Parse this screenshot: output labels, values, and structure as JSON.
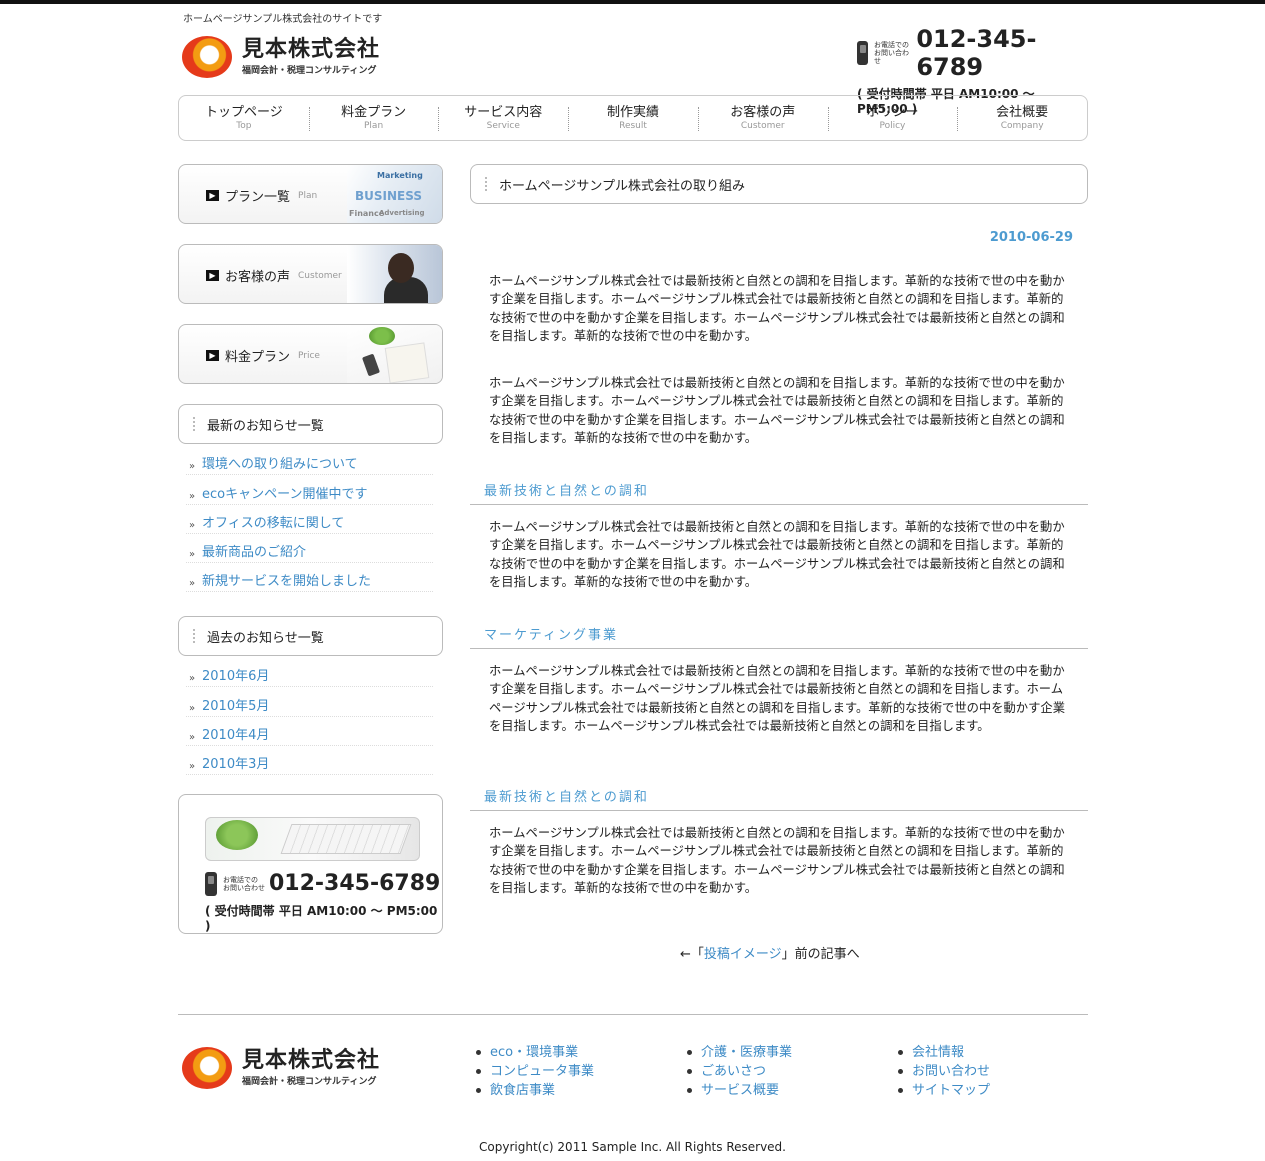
{
  "header": {
    "tagline": "ホームページサンプル株式会社のサイトです",
    "company_name": "見本株式会社",
    "company_sub": "福岡会計・税理コンサルティング",
    "tel_label_line1": "お電話での",
    "tel_label_line2": "お問い合わせ",
    "tel_number": "012-345-6789",
    "tel_hours": "( 受付時間帯 平日 AM10:00 〜 PM5:00 )"
  },
  "nav": [
    {
      "jp": "トップページ",
      "en": "Top"
    },
    {
      "jp": "料金プラン",
      "en": "Plan"
    },
    {
      "jp": "サービス内容",
      "en": "Service"
    },
    {
      "jp": "制作実績",
      "en": "Result"
    },
    {
      "jp": "お客様の声",
      "en": "Customer"
    },
    {
      "jp": "ポリシー",
      "en": "Policy"
    },
    {
      "jp": "会社概要",
      "en": "Company"
    }
  ],
  "sidebar": {
    "banners": [
      {
        "label": "プラン一覧",
        "en": "Plan"
      },
      {
        "label": "お客様の声",
        "en": "Customer"
      },
      {
        "label": "料金プラン",
        "en": "Price"
      }
    ],
    "banner_pic_words": [
      "Marketing",
      "BUSINESS",
      "Finance",
      "Advertising"
    ],
    "news_title": "最新のお知らせ一覧",
    "news": [
      "環境への取り組みについて",
      "ecoキャンペーン開催中です",
      "オフィスの移転に関して",
      "最新商品のご紹介",
      "新規サービスを開始しました"
    ],
    "archive_title": "過去のお知らせ一覧",
    "archives": [
      "2010年6月",
      "2010年5月",
      "2010年4月",
      "2010年3月"
    ],
    "tel_label_line1": "お電話での",
    "tel_label_line2": "お問い合わせ",
    "tel_number": "012-345-6789",
    "tel_hours": "( 受付時間帯 平日 AM10:00 〜 PM5:00 )"
  },
  "main": {
    "title": "ホームページサンプル株式会社の取り組み",
    "date": "2010-06-29",
    "para1": "ホームページサンプル株式会社では最新技術と自然との調和を目指します。革新的な技術で世の中を動かす企業を目指します。ホームページサンプル株式会社では最新技術と自然との調和を目指します。革新的な技術で世の中を動かす企業を目指します。ホームページサンプル株式会社では最新技術と自然との調和を目指します。革新的な技術で世の中を動かす。",
    "para2": "ホームページサンプル株式会社では最新技術と自然との調和を目指します。革新的な技術で世の中を動かす企業を目指します。ホームページサンプル株式会社では最新技術と自然との調和を目指します。革新的な技術で世の中を動かす企業を目指します。ホームページサンプル株式会社では最新技術と自然との調和を目指します。革新的な技術で世の中を動かす。",
    "section1_title": "最新技術と自然との調和",
    "section1_text": "ホームページサンプル株式会社では最新技術と自然との調和を目指します。革新的な技術で世の中を動かす企業を目指します。ホームページサンプル株式会社では最新技術と自然との調和を目指します。革新的な技術で世の中を動かす企業を目指します。ホームページサンプル株式会社では最新技術と自然との調和を目指します。革新的な技術で世の中を動かす。",
    "section2_title": "マーケティング事業",
    "section2_text": "ホームページサンプル株式会社では最新技術と自然との調和を目指します。革新的な技術で世の中を動かす企業を目指します。ホームページサンプル株式会社では最新技術と自然との調和を目指します。ホームページサンプル株式会社では最新技術と自然との調和を目指します。革新的な技術で世の中を動かす企業を目指します。ホームページサンプル株式会社では最新技術と自然との調和を目指します。",
    "section3_title": "最新技術と自然との調和",
    "section3_text": "ホームページサンプル株式会社では最新技術と自然との調和を目指します。革新的な技術で世の中を動かす企業を目指します。ホームページサンプル株式会社では最新技術と自然との調和を目指します。革新的な技術で世の中を動かす企業を目指します。ホームページサンプル株式会社では最新技術と自然との調和を目指します。革新的な技術で世の中を動かす。",
    "prev_prefix": "←「",
    "prev_link": "投稿イメージ",
    "prev_suffix": "」前の記事へ"
  },
  "footer": {
    "company_name": "見本株式会社",
    "company_sub": "福岡会計・税理コンサルティング",
    "col1": [
      "eco・環境事業",
      "コンピュータ事業",
      "飲食店事業"
    ],
    "col2": [
      "介護・医療事業",
      "ごあいさつ",
      "サービス概要"
    ],
    "col3": [
      "会社情報",
      "お問い合わせ",
      "サイトマップ"
    ],
    "copyright": "Copyright(c) 2011 Sample Inc. All Rights Reserved."
  },
  "colors": {
    "link": "#3e8bc6",
    "accent_blue": "#4d9bd0",
    "logo_red": "#e53a1a",
    "logo_orange": "#f39c12"
  }
}
